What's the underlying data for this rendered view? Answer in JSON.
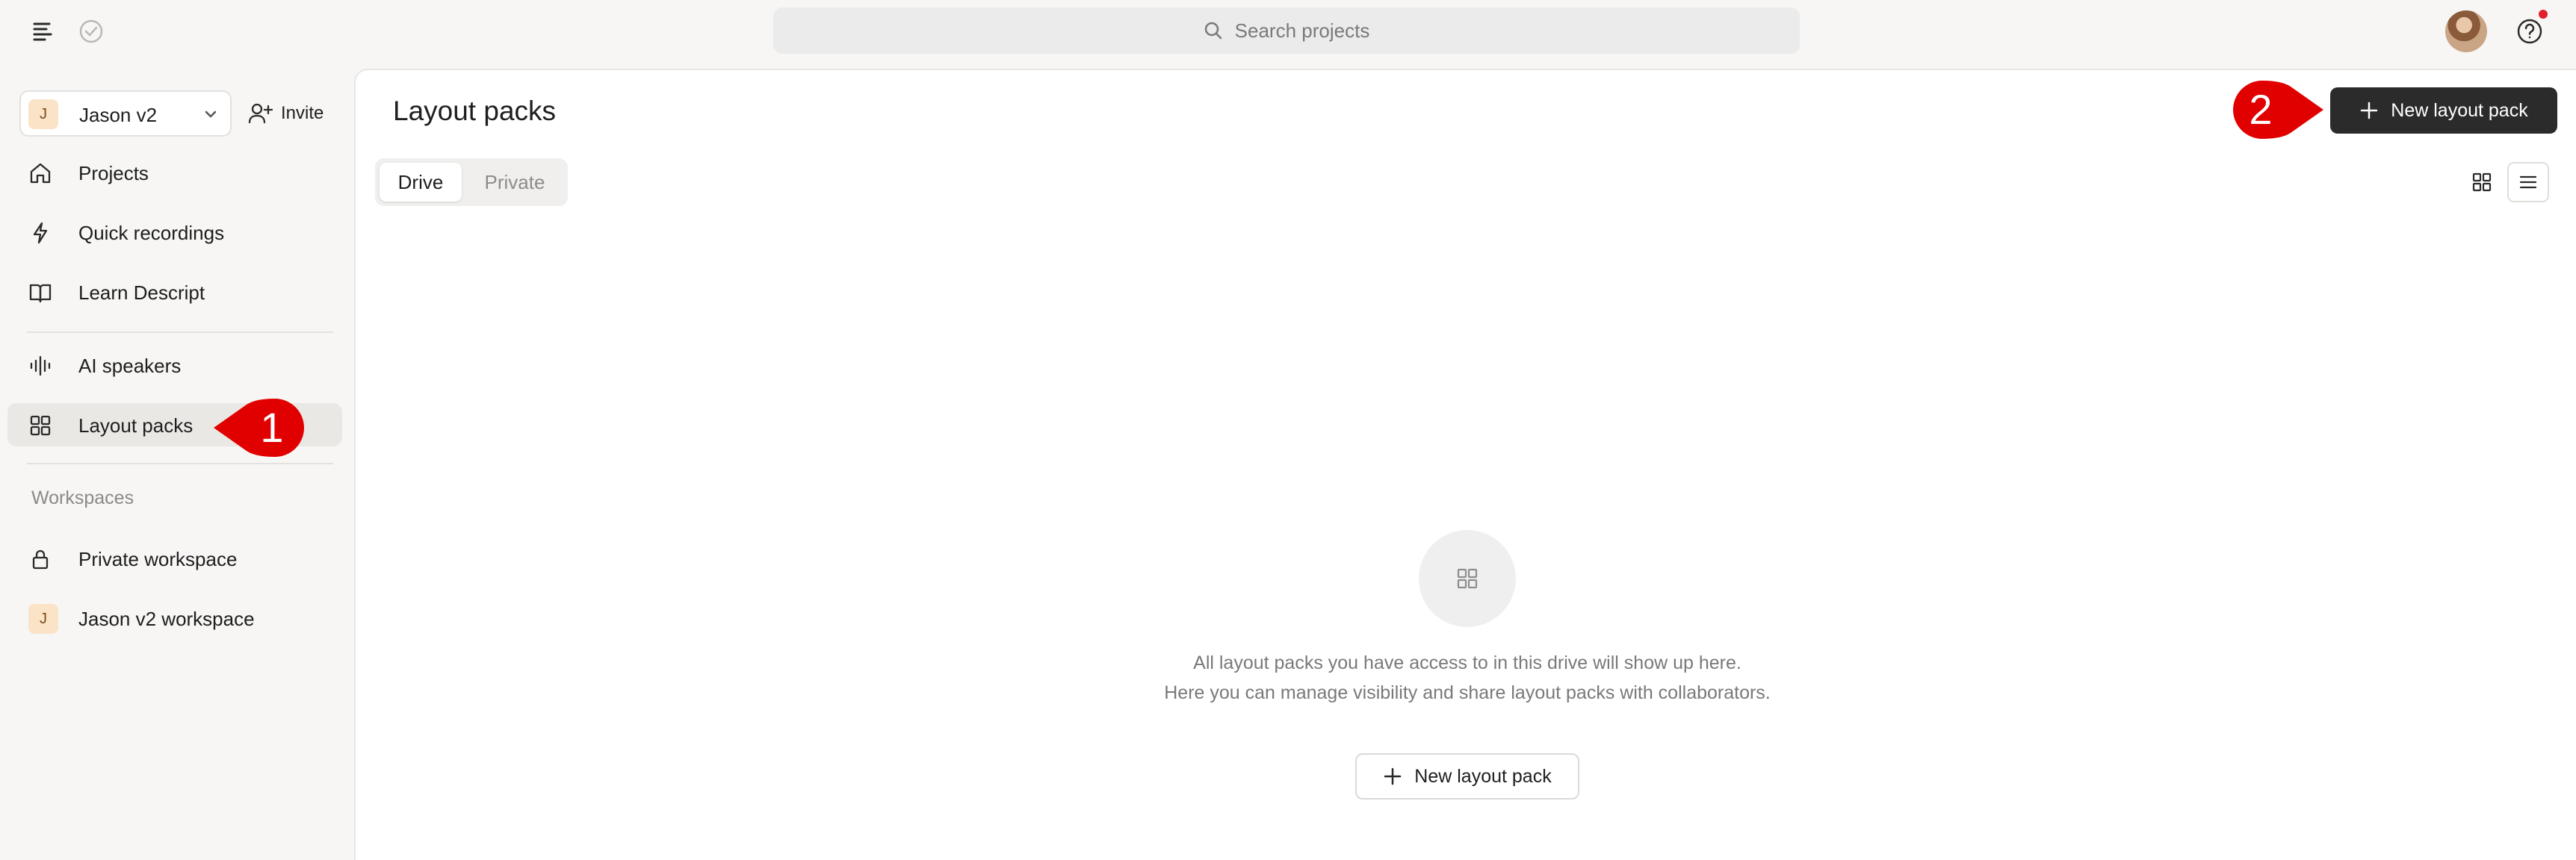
{
  "colors": {
    "accent_red": "#e10000",
    "primary_dark": "#2b2b2b",
    "badge_bg": "#fbe3c7"
  },
  "topbar": {
    "search_placeholder": "Search projects",
    "icons": [
      "menu-list-icon",
      "check-circle-icon",
      "search-icon",
      "avatar",
      "help-icon"
    ]
  },
  "sidebar": {
    "workspace": {
      "badge": "J",
      "name": "Jason v2"
    },
    "invite_label": "Invite",
    "items": [
      {
        "label": "Projects",
        "icon": "home-icon"
      },
      {
        "label": "Quick recordings",
        "icon": "lightning-icon"
      },
      {
        "label": "Learn Descript",
        "icon": "book-icon"
      },
      {
        "label": "AI speakers",
        "icon": "waveform-icon"
      },
      {
        "label": "Layout packs",
        "icon": "grid-icon",
        "active": true
      }
    ],
    "workspaces_heading": "Workspaces",
    "workspaces": [
      {
        "label": "Private workspace",
        "icon": "lock-icon"
      },
      {
        "label": "Jason v2 workspace",
        "badge": "J"
      }
    ]
  },
  "main": {
    "title": "Layout packs",
    "new_button_label": "New layout pack",
    "tabs": [
      {
        "label": "Drive",
        "selected": true
      },
      {
        "label": "Private",
        "selected": false
      }
    ],
    "empty_state": {
      "line1": "All layout packs you have access to in this drive will show up here.",
      "line2": "Here you can manage visibility and share layout packs with collaborators.",
      "button_label": "New layout pack"
    }
  },
  "callouts": [
    {
      "number": "1"
    },
    {
      "number": "2"
    }
  ]
}
